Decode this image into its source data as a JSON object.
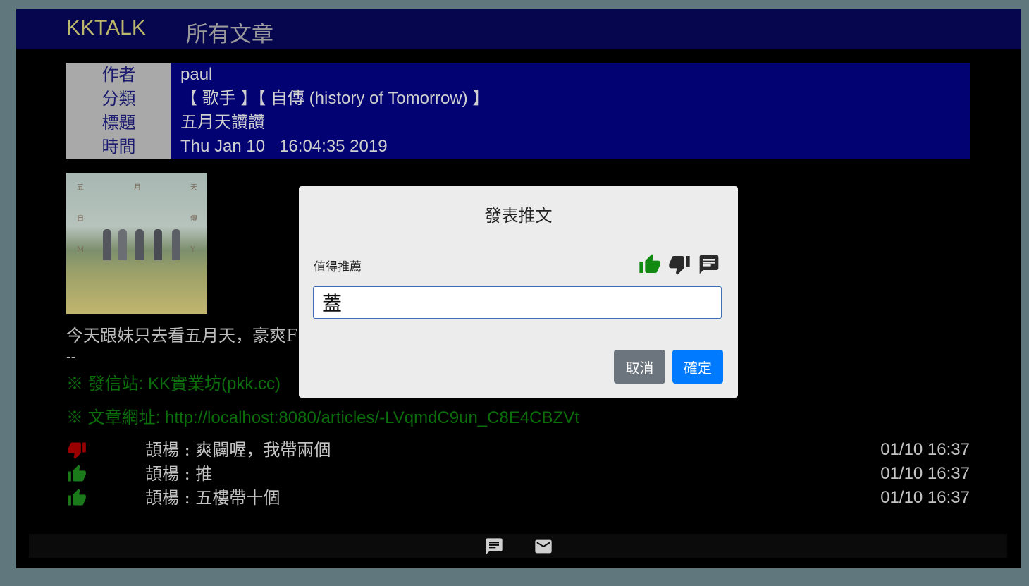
{
  "navbar": {
    "brand": "KKTALK",
    "all_articles": "所有文章"
  },
  "article": {
    "labels": [
      "作者",
      "分類",
      "標題",
      "時間"
    ],
    "author": "paul",
    "category": "【 歌手 】【 自傳 (history of Tomorrow) 】",
    "title": "五月天讚讚",
    "time": "Thu Jan 10   16:04:35 2019",
    "cover_chars": [
      "五",
      "月",
      "天",
      "自",
      "傳",
      "M",
      "Y"
    ],
    "body": "今天跟妹只去看五月天，豪爽F",
    "separator": "--",
    "source_line": "※ 發信站: KK實業坊(pkk.cc)",
    "url_line": "※ 文章網址: http://localhost:8080/articles/-LVqmdC9un_C8E4CBZVt"
  },
  "pushes": [
    {
      "type": "dislike",
      "icon": "thumb-down-icon",
      "color": "#9b0000",
      "text": "頡楊 : 爽闢喔，我帶兩個",
      "time": "01/10 16:37"
    },
    {
      "type": "like",
      "icon": "thumb-up-icon",
      "color": "#1a7a1a",
      "text": "頡楊 : 推",
      "time": "01/10 16:37"
    },
    {
      "type": "like",
      "icon": "thumb-up-icon",
      "color": "#1a7a1a",
      "text": "頡楊 : 五樓帶十個",
      "time": "01/10 16:37"
    }
  ],
  "footer": {
    "icons": [
      "comment-icon",
      "mail-icon"
    ]
  },
  "modal": {
    "title": "發表推文",
    "label": "值得推薦",
    "type_icons": [
      "thumb-up-icon",
      "thumb-down-icon",
      "comment-icon"
    ],
    "input_value": "蓋",
    "cancel": "取消",
    "ok": "確定"
  },
  "colors": {
    "page_bg": "#5f777d",
    "navbar_bg": "#06064e",
    "brand": "#bdb76b",
    "header_label_bg": "#a9a9a9",
    "header_value_bg": "#020272",
    "green_text": "#0b6d0b",
    "modal_bg": "#ececec",
    "cancel_btn": "#6c757d",
    "ok_btn": "#007bff",
    "like_green": "#1a7a1a",
    "dislike_red": "#9b0000"
  }
}
